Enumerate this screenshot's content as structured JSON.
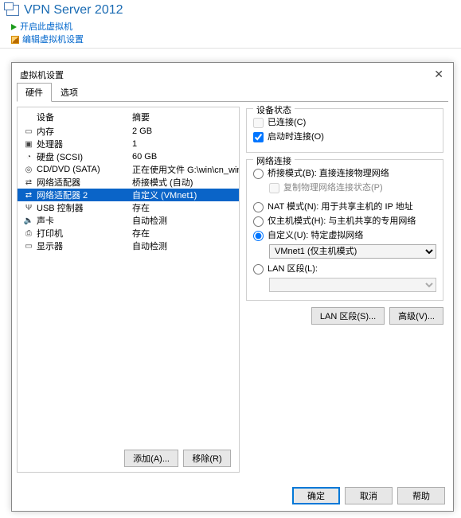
{
  "top": {
    "title": "VPN Server 2012",
    "action_open": "开启此虚拟机",
    "action_edit": "编辑虚拟机设置"
  },
  "dialog": {
    "title": "虚拟机设置",
    "tabs": {
      "hardware": "硬件",
      "options": "选项"
    },
    "headers": {
      "device": "设备",
      "summary": "摘要"
    },
    "devices": [
      {
        "icon": "i-mem",
        "name": "内存",
        "summary": "2 GB"
      },
      {
        "icon": "i-cpu",
        "name": "处理器",
        "summary": "1"
      },
      {
        "icon": "i-disk",
        "name": "硬盘 (SCSI)",
        "summary": "60 GB"
      },
      {
        "icon": "i-cd",
        "name": "CD/DVD (SATA)",
        "summary": "正在使用文件 G:\\win\\cn_wind..."
      },
      {
        "icon": "i-net",
        "name": "网络适配器",
        "summary": "桥接模式 (自动)"
      },
      {
        "icon": "i-net",
        "name": "网络适配器 2",
        "summary": "自定义 (VMnet1)",
        "selected": true
      },
      {
        "icon": "i-usb",
        "name": "USB 控制器",
        "summary": "存在"
      },
      {
        "icon": "i-snd",
        "name": "声卡",
        "summary": "自动检测"
      },
      {
        "icon": "i-prn",
        "name": "打印机",
        "summary": "存在"
      },
      {
        "icon": "i-mon",
        "name": "显示器",
        "summary": "自动检测"
      }
    ],
    "add": "添加(A)...",
    "remove": "移除(R)",
    "status_group": "设备状态",
    "cb_connected": "已连接(C)",
    "cb_connect_poweron": "启动时连接(O)",
    "net_group": "网络连接",
    "rb_bridge": "桥接模式(B): 直接连接物理网络",
    "cb_replicate": "复制物理网络连接状态(P)",
    "rb_nat": "NAT 模式(N): 用于共享主机的 IP 地址",
    "rb_hostonly": "仅主机模式(H): 与主机共享的专用网络",
    "rb_custom": "自定义(U): 特定虚拟网络",
    "custom_value": "VMnet1 (仅主机模式)",
    "rb_lan": "LAN 区段(L):",
    "btn_lan": "LAN 区段(S)...",
    "btn_adv": "高级(V)...",
    "ok": "确定",
    "cancel": "取消",
    "help": "帮助"
  }
}
